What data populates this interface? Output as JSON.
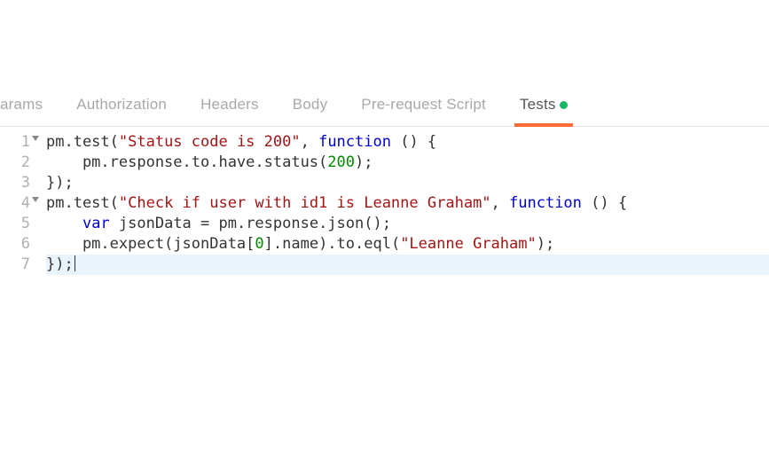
{
  "tabs": {
    "params": "arams",
    "authorization": "Authorization",
    "headers": "Headers",
    "body": "Body",
    "prerequest": "Pre-request Script",
    "tests": "Tests"
  },
  "lineNumbers": {
    "l1": "1",
    "l2": "2",
    "l3": "3",
    "l4": "4",
    "l5": "5",
    "l6": "6",
    "l7": "7"
  },
  "code": {
    "l1": {
      "a": "pm.test(",
      "str": "\"Status code is 200\"",
      "b": ", ",
      "kw": "function",
      "c": " () {"
    },
    "l2": {
      "indent": "    pm.response.to.have.status(",
      "num": "200",
      "end": ");"
    },
    "l3": {
      "txt": "});"
    },
    "l4": {
      "a": "pm.test(",
      "str": "\"Check if user with id1 is Leanne Graham\"",
      "b": ", ",
      "kw": "function",
      "c": " () {"
    },
    "l5": {
      "indent": "    ",
      "kw": "var",
      "rest": " jsonData = pm.response.json();"
    },
    "l6": {
      "a": "    pm.expect(jsonData[",
      "num": "0",
      "b": "].name).to.eql(",
      "str": "\"Leanne Graham\"",
      "c": ");"
    },
    "l7": {
      "txt": "});"
    }
  }
}
